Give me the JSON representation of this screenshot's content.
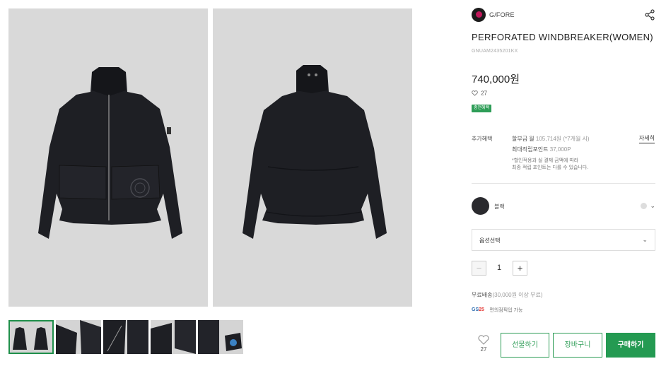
{
  "brand": {
    "name": "G/FORE"
  },
  "product": {
    "title": "PERFORATED WINDBREAKER(WOMEN)",
    "code": "GNUAM2435201KX",
    "price": "740,000원",
    "likes": "27",
    "badge": "충전혜택"
  },
  "benefits": {
    "label": "추가혜택",
    "installment_prefix": "할부금 월 ",
    "installment_value": "105,714원 (*7개월 시)",
    "points_prefix": "최대적립포인트 ",
    "points_value": "37,000P",
    "note1": "*할인적용과 실 결제 금액에 따라",
    "note2": "최종 적립 포인트는 다를 수 있습니다.",
    "detail_link": "자세히"
  },
  "color": {
    "name": "블랙",
    "swatch": "#2a2a2e"
  },
  "option": {
    "placeholder": "옵션선택"
  },
  "quantity": {
    "minus": "−",
    "value": "1",
    "plus": "+"
  },
  "shipping": {
    "label": "무료배송",
    "condition": "(30,000원 이상 무료)",
    "pickup_logo_a": "GS",
    "pickup_logo_b": "25",
    "pickup_text": "편의점픽업 가능"
  },
  "actions": {
    "like_count": "27",
    "gift": "선물하기",
    "cart": "장바구니",
    "buy": "구매하기"
  },
  "icons": {
    "share": "share-icon",
    "heart": "heart-icon",
    "chevron": "chevron-down-icon"
  },
  "colors": {
    "accent": "#2e9d57",
    "buy": "#249a52"
  }
}
